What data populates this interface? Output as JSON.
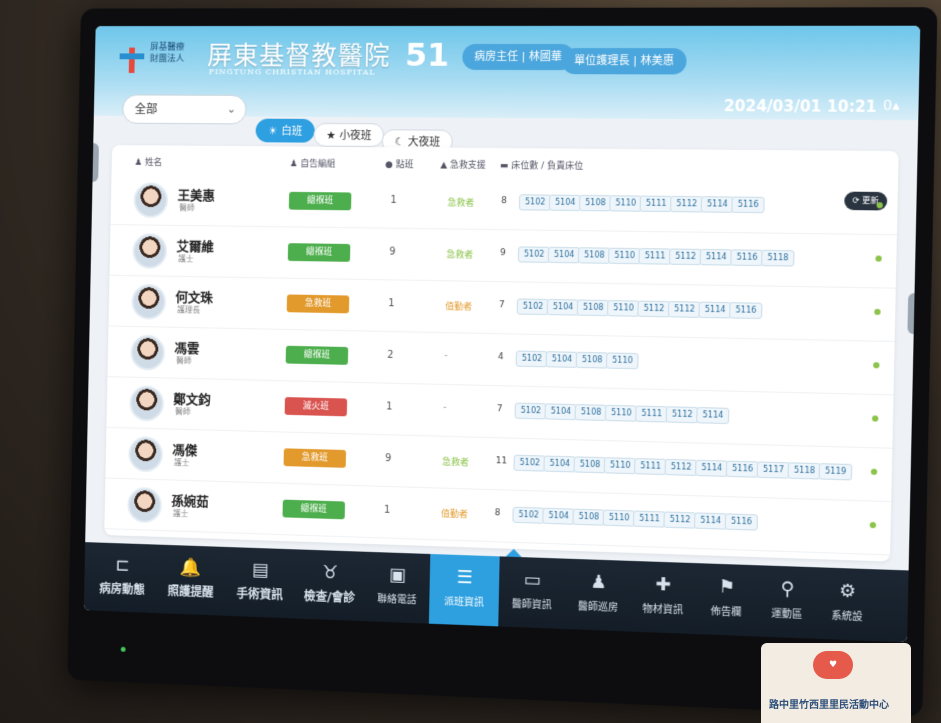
{
  "header": {
    "org_line1": "屏基醫療",
    "org_line2": "財團法人",
    "hospital_name": "屏東基督教醫院",
    "hospital_name_en": "PINGTUNG CHRISTIAN HOSPITAL",
    "bed_count": "51",
    "ward_director": "病房主任 | 林國華",
    "unit_head_nurse": "單位護理長 | 林美惠",
    "datetime": "2024/03/01 10:21",
    "signal_value": "0"
  },
  "filters": {
    "group_select": "全部",
    "shifts": [
      {
        "label": "白班",
        "icon": "sun-icon",
        "active": true
      },
      {
        "label": "小夜班",
        "icon": "star-icon",
        "active": false
      },
      {
        "label": "大夜班",
        "icon": "moon-icon",
        "active": false
      }
    ]
  },
  "table": {
    "headers": {
      "name": "姓名",
      "team": "自告編組",
      "beds": "點班",
      "support": "急救支援",
      "bed_list": "床位數 / 負責床位"
    },
    "refresh_label": "更新",
    "rows": [
      {
        "name": "王美惠",
        "title": "醫師",
        "team": "總褓班",
        "team_color": "#4cae4c",
        "beds": "1",
        "support": "急救者",
        "support_color": "#8bc34a",
        "bed_total": "8",
        "bed_chips": [
          "5102",
          "5104",
          "5108",
          "5110",
          "5111",
          "5112",
          "5114",
          "5116"
        ]
      },
      {
        "name": "艾爾維",
        "title": "護士",
        "team": "總褓班",
        "team_color": "#4cae4c",
        "beds": "9",
        "support": "急救者",
        "support_color": "#8bc34a",
        "bed_total": "9",
        "bed_chips": [
          "5102",
          "5104",
          "5108",
          "5110",
          "5111",
          "5112",
          "5114",
          "5116",
          "5118"
        ]
      },
      {
        "name": "何文珠",
        "title": "護理長",
        "team": "急救班",
        "team_color": "#e39a2d",
        "beds": "1",
        "support": "值勤者",
        "support_color": "#e39a2d",
        "bed_total": "7",
        "bed_chips": [
          "5102",
          "5104",
          "5108",
          "5110",
          "5112",
          "5112",
          "5114",
          "5116"
        ]
      },
      {
        "name": "馮雲",
        "title": "醫師",
        "team": "總褓班",
        "team_color": "#4cae4c",
        "beds": "2",
        "support": "-",
        "support_color": "#888888",
        "bed_total": "4",
        "bed_chips": [
          "5102",
          "5104",
          "5108",
          "5110"
        ]
      },
      {
        "name": "鄭文鈞",
        "title": "醫師",
        "team": "滅火班",
        "team_color": "#d9534f",
        "beds": "1",
        "support": "-",
        "support_color": "#888888",
        "bed_total": "7",
        "bed_chips": [
          "5102",
          "5104",
          "5108",
          "5110",
          "5111",
          "5112",
          "5114"
        ]
      },
      {
        "name": "馮傑",
        "title": "護士",
        "team": "急救班",
        "team_color": "#e39a2d",
        "beds": "9",
        "support": "急救者",
        "support_color": "#8bc34a",
        "bed_total": "11",
        "bed_chips": [
          "5102",
          "5104",
          "5108",
          "5110",
          "5111",
          "5112",
          "5114",
          "5116",
          "5117",
          "5118",
          "5119"
        ]
      },
      {
        "name": "孫婉茹",
        "title": "護士",
        "team": "總褓班",
        "team_color": "#4cae4c",
        "beds": "1",
        "support": "值勤者",
        "support_color": "#e39a2d",
        "bed_total": "8",
        "bed_chips": [
          "5102",
          "5104",
          "5108",
          "5110",
          "5111",
          "5112",
          "5114",
          "5116"
        ]
      }
    ]
  },
  "nav": {
    "items": [
      {
        "label": "病房動態",
        "icon": "bed-icon",
        "big": true
      },
      {
        "label": "照護提醒",
        "icon": "bell-icon",
        "big": true
      },
      {
        "label": "手術資訊",
        "icon": "clipboard-icon",
        "big": true
      },
      {
        "label": "檢查/會診",
        "icon": "stethoscope-icon",
        "big": true
      },
      {
        "label": "聯絡電話",
        "icon": "phonebook-icon",
        "big": false
      },
      {
        "label": "派班資訊",
        "icon": "list-icon",
        "big": false,
        "active": true
      },
      {
        "label": "醫師資訊",
        "icon": "id-card-icon",
        "big": false
      },
      {
        "label": "醫師巡房",
        "icon": "doctor-icon",
        "big": false
      },
      {
        "label": "物材資訊",
        "icon": "medkit-icon",
        "big": false
      },
      {
        "label": "佈告欄",
        "icon": "megaphone-icon",
        "big": false
      },
      {
        "label": "運動區",
        "icon": "running-icon",
        "big": false
      },
      {
        "label": "系統設",
        "icon": "gear-icon",
        "big": false
      }
    ]
  },
  "poster": {
    "text": "路中里竹西里里民活動中心"
  }
}
